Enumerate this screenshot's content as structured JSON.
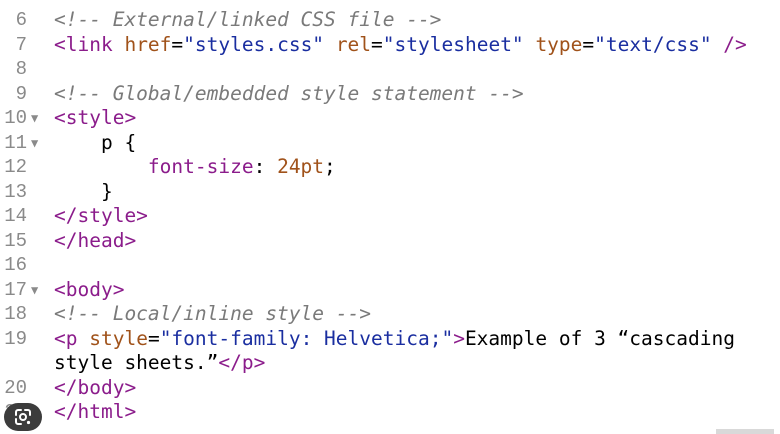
{
  "lines": [
    {
      "num": "6",
      "fold": "",
      "parts": [
        {
          "t": "<!-- External/linked CSS file -->",
          "c": "comment"
        }
      ]
    },
    {
      "num": "7",
      "fold": "",
      "parts": [
        {
          "t": "<link ",
          "c": "tag"
        },
        {
          "t": "href",
          "c": "attr"
        },
        {
          "t": "=",
          "c": ""
        },
        {
          "t": "\"styles.css\"",
          "c": "str"
        },
        {
          "t": " ",
          "c": ""
        },
        {
          "t": "rel",
          "c": "attr"
        },
        {
          "t": "=",
          "c": ""
        },
        {
          "t": "\"stylesheet\"",
          "c": "str"
        },
        {
          "t": " ",
          "c": ""
        },
        {
          "t": "type",
          "c": "attr"
        },
        {
          "t": "=",
          "c": ""
        },
        {
          "t": "\"text/css\"",
          "c": "str"
        },
        {
          "t": " />",
          "c": "tag"
        }
      ]
    },
    {
      "num": "8",
      "fold": "",
      "parts": []
    },
    {
      "num": "9",
      "fold": "",
      "parts": [
        {
          "t": "<!-- Global/embedded style statement -->",
          "c": "comment"
        }
      ]
    },
    {
      "num": "10",
      "fold": "▼",
      "parts": [
        {
          "t": "<style>",
          "c": "tag"
        }
      ]
    },
    {
      "num": "11",
      "fold": "▼",
      "parts": [
        {
          "t": "    p {",
          "c": ""
        }
      ]
    },
    {
      "num": "12",
      "fold": "",
      "parts": [
        {
          "t": "        ",
          "c": ""
        },
        {
          "t": "font-size",
          "c": "prop"
        },
        {
          "t": ": ",
          "c": ""
        },
        {
          "t": "24pt",
          "c": "num"
        },
        {
          "t": ";",
          "c": ""
        }
      ]
    },
    {
      "num": "13",
      "fold": "",
      "parts": [
        {
          "t": "    }",
          "c": ""
        }
      ]
    },
    {
      "num": "14",
      "fold": "",
      "parts": [
        {
          "t": "</style>",
          "c": "tag"
        }
      ]
    },
    {
      "num": "15",
      "fold": "",
      "parts": [
        {
          "t": "</head>",
          "c": "tag"
        }
      ]
    },
    {
      "num": "16",
      "fold": "",
      "parts": []
    },
    {
      "num": "17",
      "fold": "▼",
      "parts": [
        {
          "t": "<body>",
          "c": "tag"
        }
      ]
    },
    {
      "num": "18",
      "fold": "",
      "parts": [
        {
          "t": "<!-- Local/inline style -->",
          "c": "comment"
        }
      ]
    },
    {
      "num": "19",
      "fold": "",
      "parts": [
        {
          "t": "<p ",
          "c": "tag"
        },
        {
          "t": "style",
          "c": "attr"
        },
        {
          "t": "=",
          "c": ""
        },
        {
          "t": "\"font-family: Helvetica;\"",
          "c": "str"
        },
        {
          "t": ">",
          "c": "tag"
        },
        {
          "t": "Example of 3 “cascading",
          "c": ""
        }
      ]
    },
    {
      "num": "",
      "fold": "",
      "parts": [
        {
          "t": "style sheets.”",
          "c": ""
        },
        {
          "t": "</p>",
          "c": "tag"
        }
      ]
    },
    {
      "num": "20",
      "fold": "",
      "parts": [
        {
          "t": "</body>",
          "c": "tag"
        }
      ]
    },
    {
      "num": "21",
      "fold": "",
      "parts": [
        {
          "t": "</html>",
          "c": "tag"
        }
      ]
    }
  ],
  "icons": {
    "lens": "google-lens-icon"
  }
}
